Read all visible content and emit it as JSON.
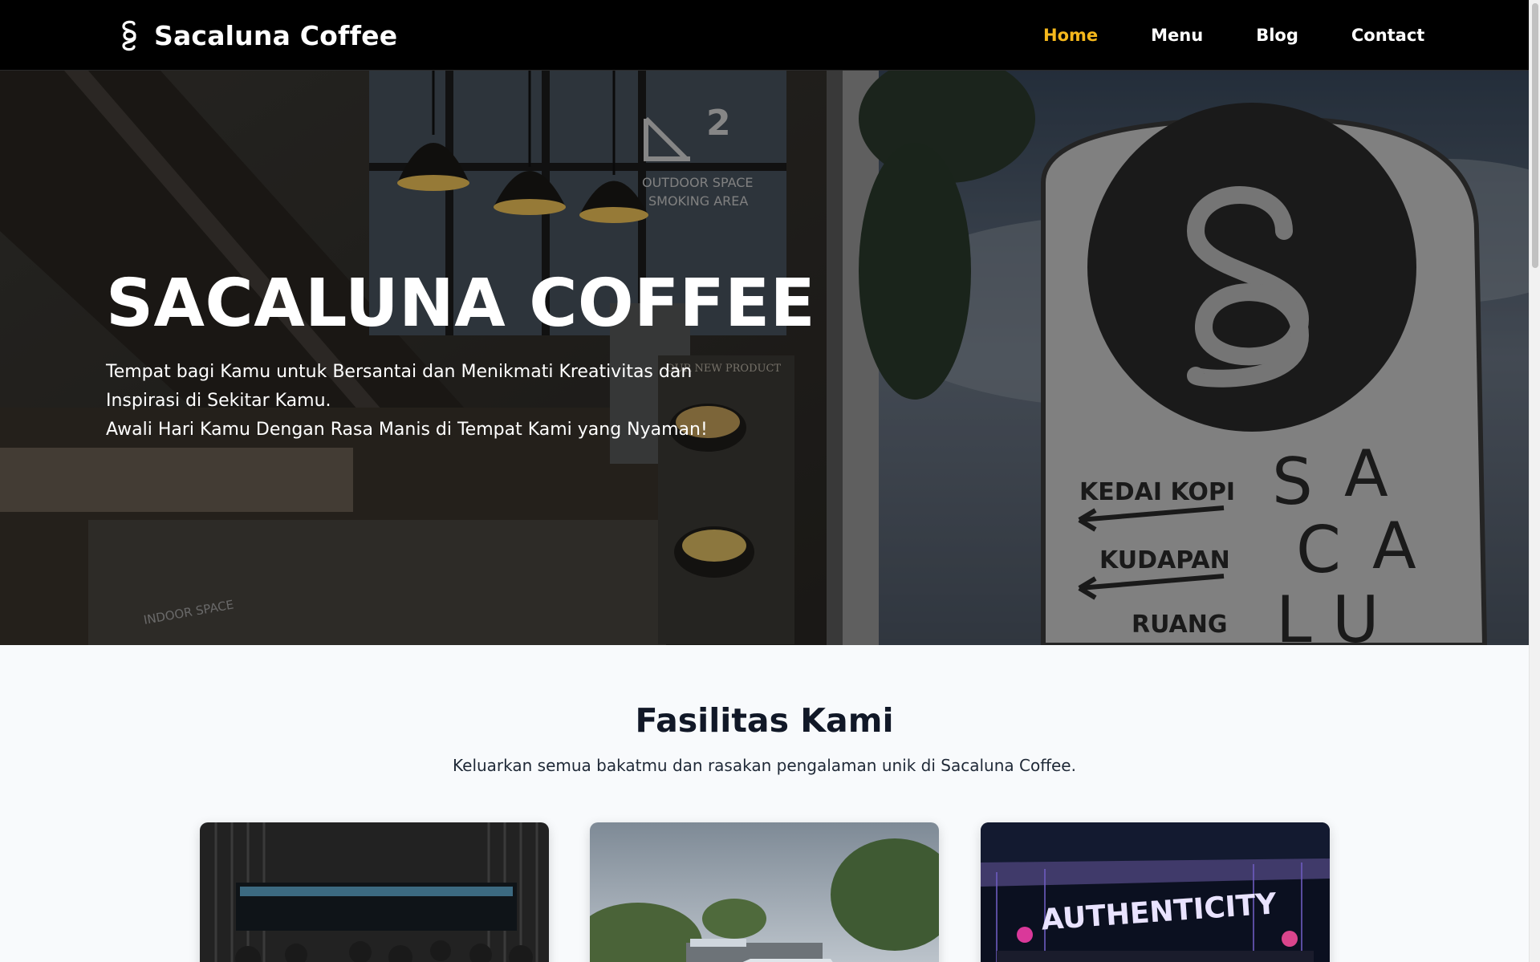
{
  "navbar": {
    "brand": "Sacaluna Coffee",
    "links": [
      {
        "label": "Home",
        "active": true
      },
      {
        "label": "Menu",
        "active": false
      },
      {
        "label": "Blog",
        "active": false
      },
      {
        "label": "Contact",
        "active": false
      }
    ]
  },
  "hero": {
    "title": "SACALUNA COFFEE",
    "line1": "Tempat bagi Kamu untuk Bersantai dan Menikmati Kreativitas dan Inspirasi di Sekitar Kamu.",
    "line2": "Awali Hari Kamu Dengan Rasa Manis di Tempat Kami yang Nyaman!",
    "photo_sign": {
      "floor_number": "2",
      "floor_line1": "OUTDOOR SPACE",
      "floor_line2": "SMOKING AREA",
      "menu_board": "OUR NEW PRODUCT",
      "counter_sign": "INDOOR SPACE",
      "direction1": "KEDAI KOPI",
      "direction2": "KUDAPAN",
      "direction3": "RUANG",
      "vertical_letters": [
        "S",
        "A",
        "C",
        "A",
        "L",
        "U"
      ]
    }
  },
  "fasilitas": {
    "title": "Fasilitas Kami",
    "subtitle": "Keluarkan semua bakatmu dan rasakan pengalaman unik di Sacaluna Coffee.",
    "cards": [
      {
        "icon": "indoor-hall-photo"
      },
      {
        "icon": "outdoor-garden-photo"
      },
      {
        "icon": "live-music-stage-photo",
        "sign": "AUTHENTICITY"
      }
    ]
  },
  "colors": {
    "accent": "#f5b81c",
    "navbar_bg": "#000000",
    "page_bg": "#f8fafc"
  }
}
